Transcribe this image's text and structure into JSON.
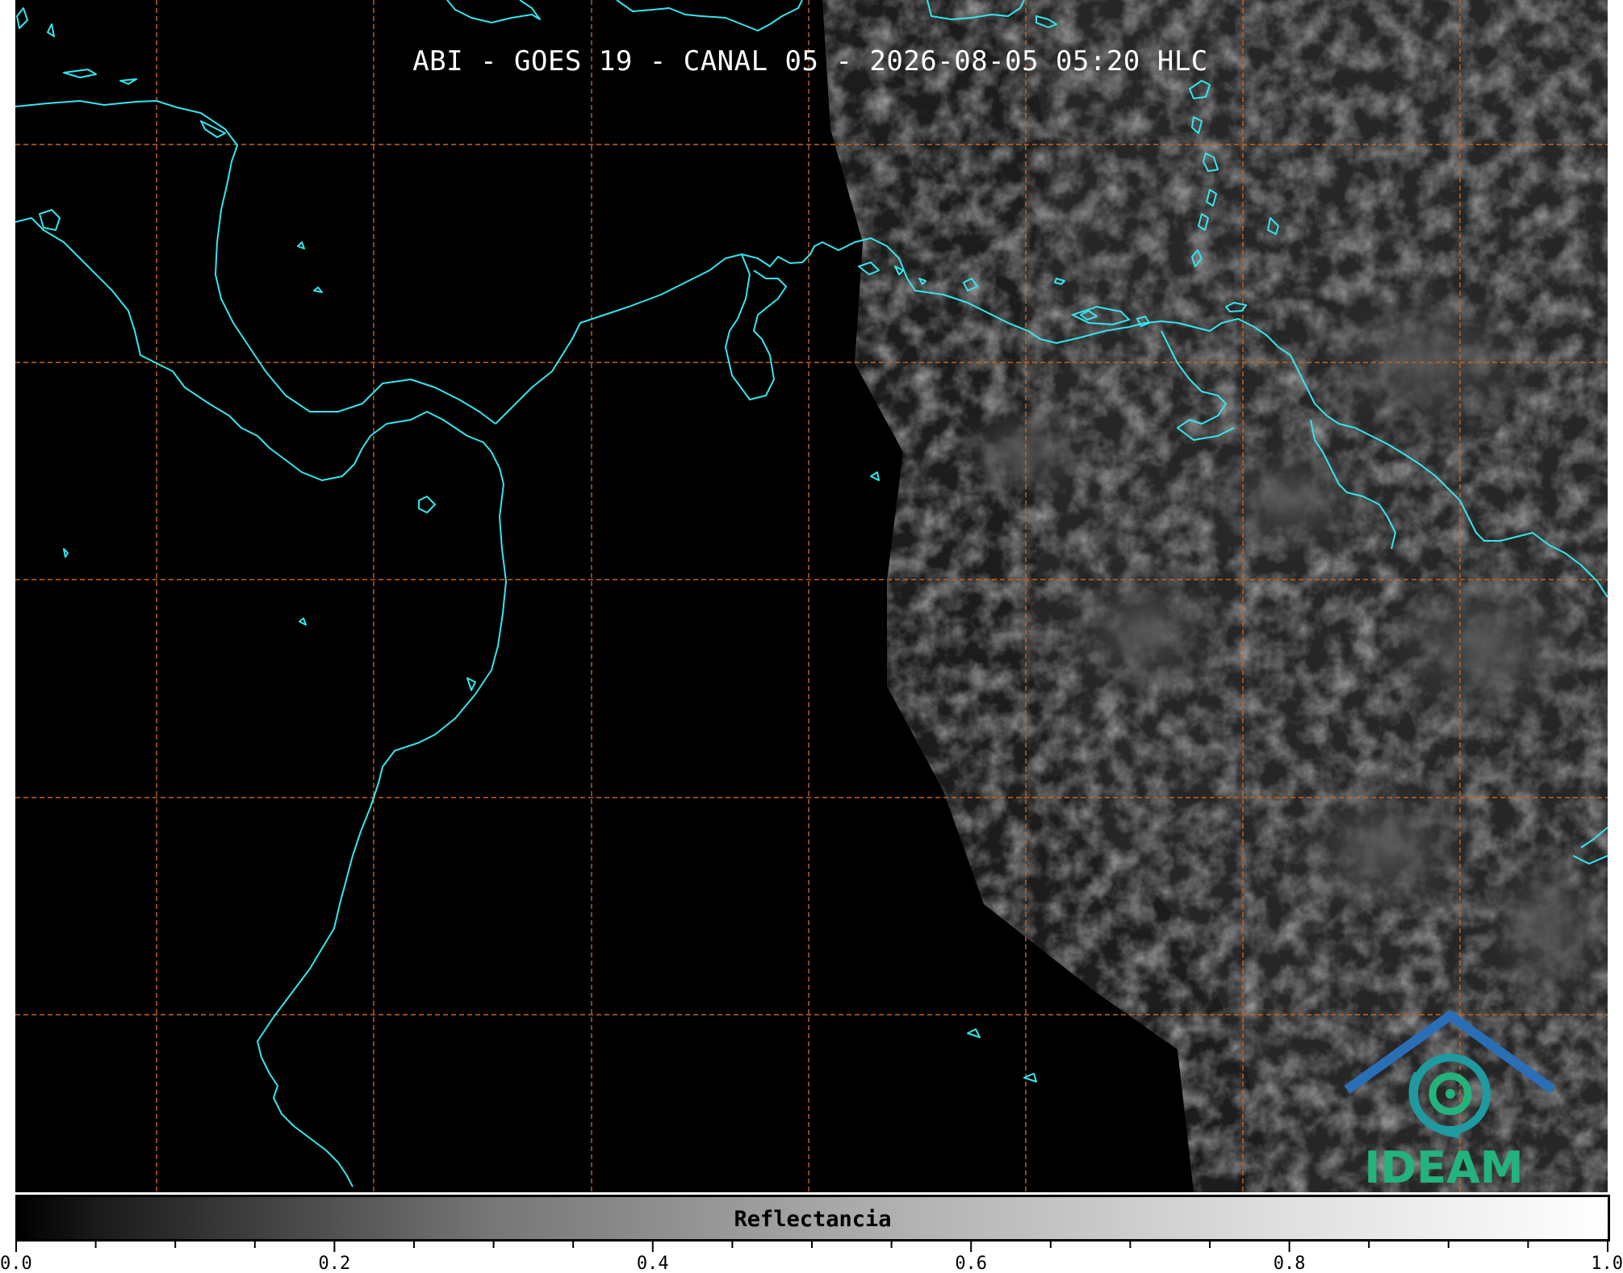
{
  "title": "ABI - GOES 19 - CANAL 05 - 2026-08-05 05:20 HLC",
  "colorbar": {
    "label": "Reflectancia",
    "ticks": [
      "0.0",
      "0.2",
      "0.4",
      "0.6",
      "0.8",
      "1.0"
    ],
    "range": [
      0.0,
      1.0
    ]
  },
  "logo": {
    "text": "IDEAM"
  },
  "colors": {
    "coastline": "#33e6ee",
    "gridlines": "#c8641e",
    "background": "#000000",
    "logo_text": "#23b47e",
    "logo_top": "#2a6fb5"
  }
}
